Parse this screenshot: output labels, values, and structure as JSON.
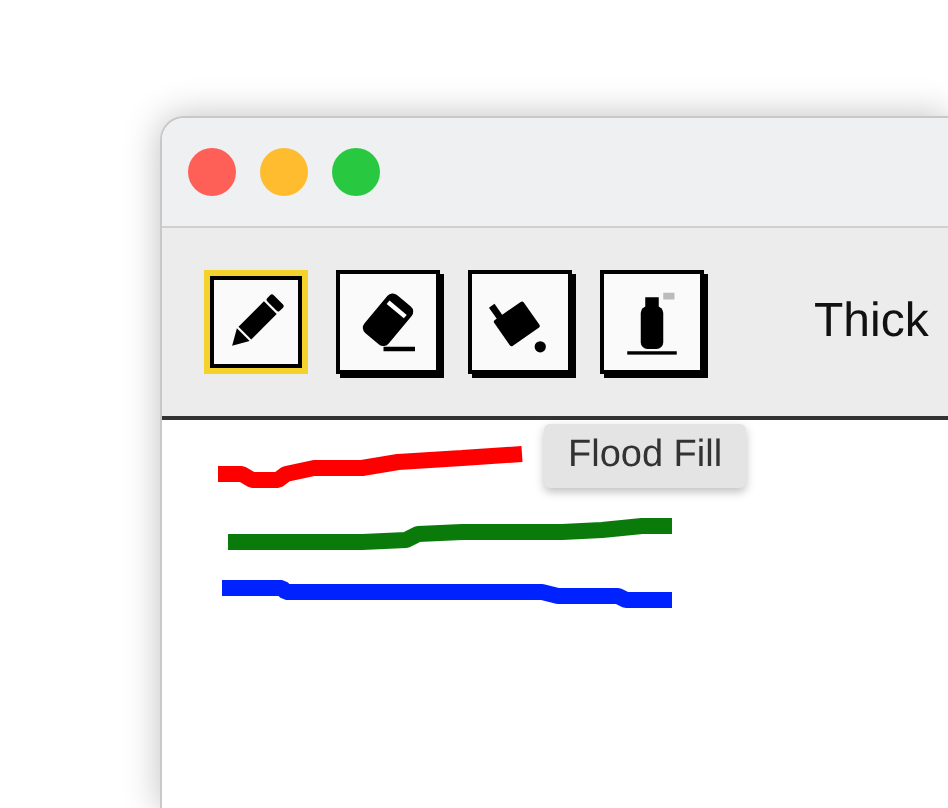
{
  "toolbar": {
    "tools": [
      {
        "kind": "pencil",
        "selected": true
      },
      {
        "kind": "eraser",
        "selected": false
      },
      {
        "kind": "fill",
        "selected": false
      },
      {
        "kind": "spray",
        "selected": false
      }
    ],
    "thickness_label": "Thick"
  },
  "tooltip": "Flood Fill",
  "canvas": {
    "strokes": [
      {
        "color": "#ff0000"
      },
      {
        "color": "#0a7a0a"
      },
      {
        "color": "#0022ff"
      }
    ]
  }
}
